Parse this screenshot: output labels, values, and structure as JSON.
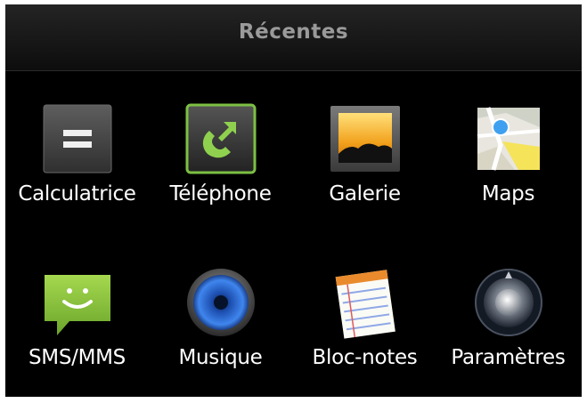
{
  "header": {
    "title": "Récentes"
  },
  "apps": [
    {
      "label": "Calculatrice",
      "icon": "calculator-icon"
    },
    {
      "label": "Téléphone",
      "icon": "phone-icon"
    },
    {
      "label": "Galerie",
      "icon": "gallery-icon"
    },
    {
      "label": "Maps",
      "icon": "maps-icon"
    },
    {
      "label": "SMS/MMS",
      "icon": "messaging-icon"
    },
    {
      "label": "Musique",
      "icon": "music-icon"
    },
    {
      "label": "Bloc-notes",
      "icon": "notepad-icon"
    },
    {
      "label": "Paramètres",
      "icon": "settings-icon"
    }
  ],
  "colors": {
    "background": "#000000",
    "header_text": "#9a9a9a",
    "label_text": "#ffffff",
    "phone_green": "#7cc043",
    "sms_green": "#8cc63f",
    "music_blue": "#2d6fd6"
  }
}
